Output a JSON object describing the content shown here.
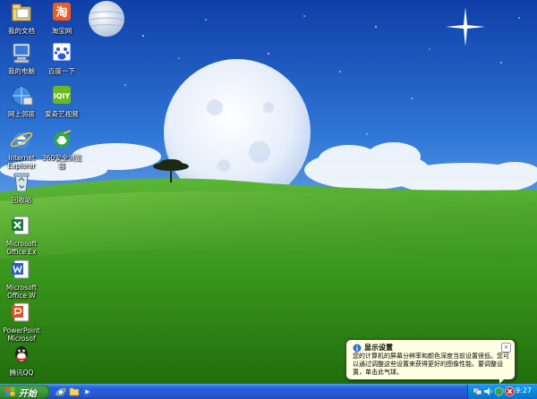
{
  "desktop_icons": [
    {
      "label": "我的文档",
      "icon": "my-documents-icon"
    },
    {
      "label": "我的电脑",
      "icon": "my-computer-icon"
    },
    {
      "label": "网上邻居",
      "icon": "network-places-icon"
    },
    {
      "label": "Internet\nExplorer",
      "icon": "internet-explorer-icon"
    },
    {
      "label": "回收站",
      "icon": "recycle-bin-icon"
    },
    {
      "label": "Microsoft\nOffice Ex",
      "icon": "excel-icon"
    },
    {
      "label": "Microsoft\nOffice W",
      "icon": "word-icon"
    },
    {
      "label": "PowerPoint\nMicrosof",
      "icon": "powerpoint-icon"
    },
    {
      "label": "腾讯QQ",
      "icon": "qq-icon"
    },
    {
      "label": "淘宝网",
      "icon": "taobao-icon"
    },
    {
      "label": "百度一下",
      "icon": "baidu-icon"
    },
    {
      "label": "爱奇艺视频",
      "icon": "iqiyi-icon"
    },
    {
      "label": "360安全浏览\n器",
      "icon": "360-browser-icon"
    }
  ],
  "taskbar": {
    "start_label": "开始",
    "quick_launch": [
      "ie-quicklaunch-icon",
      "folder-quicklaunch-icon",
      "media-quicklaunch-icon"
    ],
    "tray_icons": [
      "network-tray-icon",
      "volume-tray-icon",
      "security-tray-icon",
      "display-warning-tray-icon"
    ],
    "clock": "9:27"
  },
  "balloon": {
    "title": "显示设置",
    "body": "您的计算机的屏幕分辨率和颜色深度当前设置很低。您可以通过调整这些设置来获得更好的图像性能。要调整设置，单击此气球。",
    "close_label": "×"
  },
  "colors": {
    "sky_top": "#1f5fc4",
    "grass": "#3c9a1c",
    "taskbar": "#245edb",
    "start_green": "#3c9c3c",
    "tray_blue": "#0c86dd",
    "balloon_bg": "#ffffe1"
  }
}
